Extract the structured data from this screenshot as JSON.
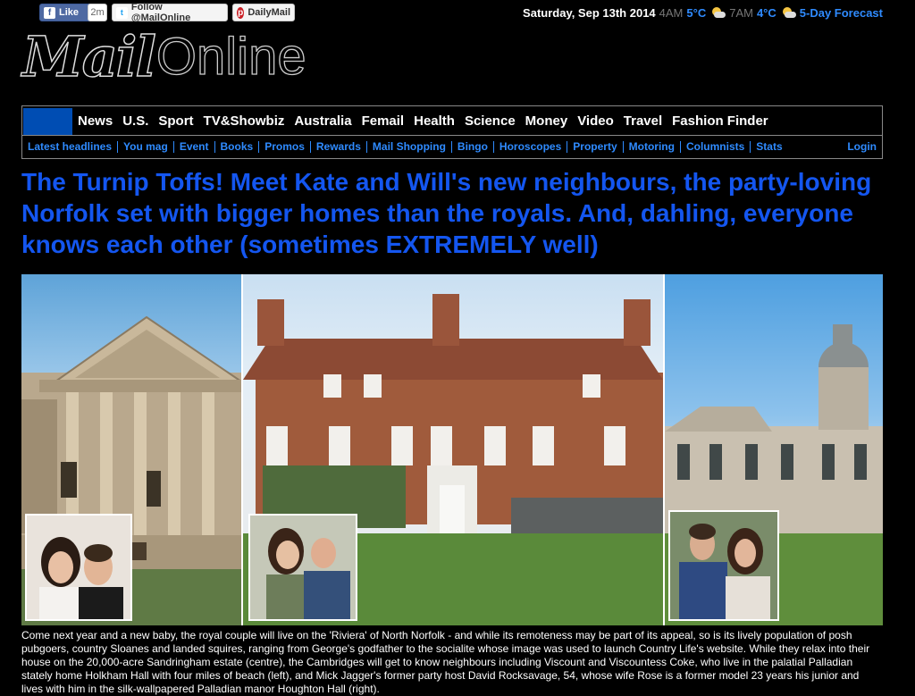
{
  "social": {
    "fb_like": "Like",
    "fb_count": "2m",
    "twitter_follow": "Follow @MailOnline",
    "pinterest_follow": "DailyMail"
  },
  "dateline": {
    "date": "Saturday, Sep 13th 2014",
    "time1": "4AM",
    "temp1": "5°C",
    "time2": "7AM",
    "temp2": "4°C",
    "forecast": "5-Day Forecast"
  },
  "logo": {
    "mail": "Mail",
    "online": "Online"
  },
  "nav": {
    "items": [
      "News",
      "U.S.",
      "Sport",
      "TV&Showbiz",
      "Australia",
      "Femail",
      "Health",
      "Science",
      "Money",
      "Video",
      "Travel",
      "Fashion Finder"
    ]
  },
  "subnav": {
    "items": [
      "Latest headlines",
      "You mag",
      "Event",
      "Books",
      "Promos",
      "Rewards",
      "Mail Shopping",
      "Bingo",
      "Horoscopes",
      "Property",
      "Motoring",
      "Columnists",
      "Stats"
    ],
    "login": "Login"
  },
  "article": {
    "headline": "The Turnip Toffs! Meet Kate and Will's new neighbours, the party-loving Norfolk set with bigger homes than the royals. And, dahling, everyone knows each other (sometimes EXTREMELY well)",
    "caption": "Come next year and a new baby, the royal couple will live on the 'Riviera' of North Norfolk - and while its remoteness may be part of its appeal, so is its lively population of posh pubgoers, country Sloanes and landed squires, ranging from George's godfather to the socialite whose image was used to launch Country Life's website. While they relax into their house on the 20,000-acre Sandringham estate (centre), the Cambridges will get to know neighbours including Viscount and Viscountess Coke, who live in the palatial Palladian stately home Holkham Hall with four miles of beach (left), and Mick Jagger's former party host David Rocksavage, 54, whose wife Rose is a former model 23 years his junior and lives with him in the silk-wallpapered Palladian manor Houghton Hall (right)."
  },
  "colors": {
    "link_blue": "#2f8bff",
    "headline_blue": "#1456f0",
    "nav_home_active": "#004db3",
    "background": "#000000"
  }
}
